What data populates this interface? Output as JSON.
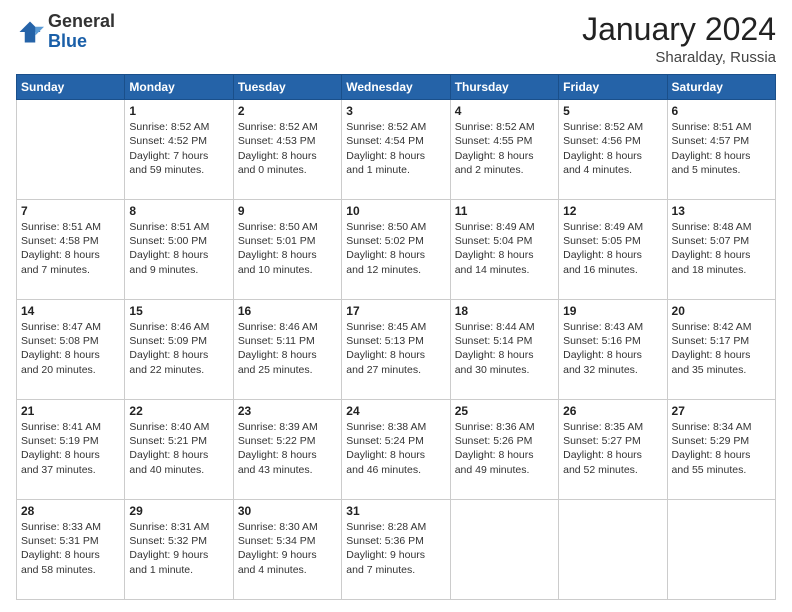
{
  "logo": {
    "general": "General",
    "blue": "Blue"
  },
  "title": "January 2024",
  "subtitle": "Sharalday, Russia",
  "header_days": [
    "Sunday",
    "Monday",
    "Tuesday",
    "Wednesday",
    "Thursday",
    "Friday",
    "Saturday"
  ],
  "weeks": [
    [
      {
        "day": "",
        "info": ""
      },
      {
        "day": "1",
        "info": "Sunrise: 8:52 AM\nSunset: 4:52 PM\nDaylight: 7 hours\nand 59 minutes."
      },
      {
        "day": "2",
        "info": "Sunrise: 8:52 AM\nSunset: 4:53 PM\nDaylight: 8 hours\nand 0 minutes."
      },
      {
        "day": "3",
        "info": "Sunrise: 8:52 AM\nSunset: 4:54 PM\nDaylight: 8 hours\nand 1 minute."
      },
      {
        "day": "4",
        "info": "Sunrise: 8:52 AM\nSunset: 4:55 PM\nDaylight: 8 hours\nand 2 minutes."
      },
      {
        "day": "5",
        "info": "Sunrise: 8:52 AM\nSunset: 4:56 PM\nDaylight: 8 hours\nand 4 minutes."
      },
      {
        "day": "6",
        "info": "Sunrise: 8:51 AM\nSunset: 4:57 PM\nDaylight: 8 hours\nand 5 minutes."
      }
    ],
    [
      {
        "day": "7",
        "info": "Sunrise: 8:51 AM\nSunset: 4:58 PM\nDaylight: 8 hours\nand 7 minutes."
      },
      {
        "day": "8",
        "info": "Sunrise: 8:51 AM\nSunset: 5:00 PM\nDaylight: 8 hours\nand 9 minutes."
      },
      {
        "day": "9",
        "info": "Sunrise: 8:50 AM\nSunset: 5:01 PM\nDaylight: 8 hours\nand 10 minutes."
      },
      {
        "day": "10",
        "info": "Sunrise: 8:50 AM\nSunset: 5:02 PM\nDaylight: 8 hours\nand 12 minutes."
      },
      {
        "day": "11",
        "info": "Sunrise: 8:49 AM\nSunset: 5:04 PM\nDaylight: 8 hours\nand 14 minutes."
      },
      {
        "day": "12",
        "info": "Sunrise: 8:49 AM\nSunset: 5:05 PM\nDaylight: 8 hours\nand 16 minutes."
      },
      {
        "day": "13",
        "info": "Sunrise: 8:48 AM\nSunset: 5:07 PM\nDaylight: 8 hours\nand 18 minutes."
      }
    ],
    [
      {
        "day": "14",
        "info": "Sunrise: 8:47 AM\nSunset: 5:08 PM\nDaylight: 8 hours\nand 20 minutes."
      },
      {
        "day": "15",
        "info": "Sunrise: 8:46 AM\nSunset: 5:09 PM\nDaylight: 8 hours\nand 22 minutes."
      },
      {
        "day": "16",
        "info": "Sunrise: 8:46 AM\nSunset: 5:11 PM\nDaylight: 8 hours\nand 25 minutes."
      },
      {
        "day": "17",
        "info": "Sunrise: 8:45 AM\nSunset: 5:13 PM\nDaylight: 8 hours\nand 27 minutes."
      },
      {
        "day": "18",
        "info": "Sunrise: 8:44 AM\nSunset: 5:14 PM\nDaylight: 8 hours\nand 30 minutes."
      },
      {
        "day": "19",
        "info": "Sunrise: 8:43 AM\nSunset: 5:16 PM\nDaylight: 8 hours\nand 32 minutes."
      },
      {
        "day": "20",
        "info": "Sunrise: 8:42 AM\nSunset: 5:17 PM\nDaylight: 8 hours\nand 35 minutes."
      }
    ],
    [
      {
        "day": "21",
        "info": "Sunrise: 8:41 AM\nSunset: 5:19 PM\nDaylight: 8 hours\nand 37 minutes."
      },
      {
        "day": "22",
        "info": "Sunrise: 8:40 AM\nSunset: 5:21 PM\nDaylight: 8 hours\nand 40 minutes."
      },
      {
        "day": "23",
        "info": "Sunrise: 8:39 AM\nSunset: 5:22 PM\nDaylight: 8 hours\nand 43 minutes."
      },
      {
        "day": "24",
        "info": "Sunrise: 8:38 AM\nSunset: 5:24 PM\nDaylight: 8 hours\nand 46 minutes."
      },
      {
        "day": "25",
        "info": "Sunrise: 8:36 AM\nSunset: 5:26 PM\nDaylight: 8 hours\nand 49 minutes."
      },
      {
        "day": "26",
        "info": "Sunrise: 8:35 AM\nSunset: 5:27 PM\nDaylight: 8 hours\nand 52 minutes."
      },
      {
        "day": "27",
        "info": "Sunrise: 8:34 AM\nSunset: 5:29 PM\nDaylight: 8 hours\nand 55 minutes."
      }
    ],
    [
      {
        "day": "28",
        "info": "Sunrise: 8:33 AM\nSunset: 5:31 PM\nDaylight: 8 hours\nand 58 minutes."
      },
      {
        "day": "29",
        "info": "Sunrise: 8:31 AM\nSunset: 5:32 PM\nDaylight: 9 hours\nand 1 minute."
      },
      {
        "day": "30",
        "info": "Sunrise: 8:30 AM\nSunset: 5:34 PM\nDaylight: 9 hours\nand 4 minutes."
      },
      {
        "day": "31",
        "info": "Sunrise: 8:28 AM\nSunset: 5:36 PM\nDaylight: 9 hours\nand 7 minutes."
      },
      {
        "day": "",
        "info": ""
      },
      {
        "day": "",
        "info": ""
      },
      {
        "day": "",
        "info": ""
      }
    ]
  ]
}
